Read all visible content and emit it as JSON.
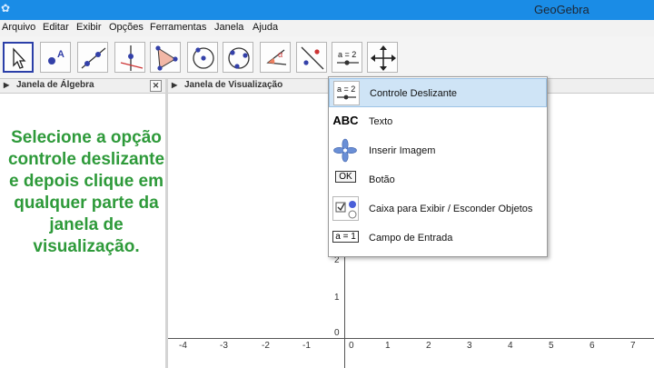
{
  "window": {
    "title": "GeoGebra"
  },
  "menu": [
    "Arquivo",
    "Editar",
    "Exibir",
    "Opções",
    "Ferramentas",
    "Janela",
    "Ajuda"
  ],
  "toolbar": {
    "tools": [
      "move",
      "point",
      "line",
      "perpendicular-line",
      "polygon",
      "circle",
      "conic",
      "angle",
      "reflect",
      "slider",
      "move-graphics-view"
    ],
    "slider_icon_label": "a = 2"
  },
  "panels": {
    "algebra_title": "Janela de Álgebra",
    "graphics_title": "Janela de Visualização"
  },
  "instruction": "Selecione a opção controle deslizante e depois clique em qualquer parte da janela de visualização.",
  "dropdown": {
    "items": [
      {
        "icon": "slider-icon",
        "icon_text": "a = 2",
        "label": "Controle Deslizante",
        "highlighted": true
      },
      {
        "icon": "text-icon",
        "icon_text": "ABC",
        "label": "Texto"
      },
      {
        "icon": "image-icon",
        "icon_text": "",
        "label": "Inserir Imagem"
      },
      {
        "icon": "button-icon",
        "icon_text": "OK",
        "label": "Botão"
      },
      {
        "icon": "checkbox-icon",
        "icon_text": "",
        "label": "Caixa para Exibir / Esconder Objetos"
      },
      {
        "icon": "input-box-icon",
        "icon_text": "a = 1",
        "label": "Campo de Entrada"
      }
    ]
  },
  "axes": {
    "x_ticks": [
      "-4",
      "-3",
      "-2",
      "-1",
      "0",
      "1",
      "2",
      "3",
      "4",
      "5",
      "6",
      "7"
    ],
    "y_ticks": [
      "2",
      "1",
      "0"
    ]
  }
}
